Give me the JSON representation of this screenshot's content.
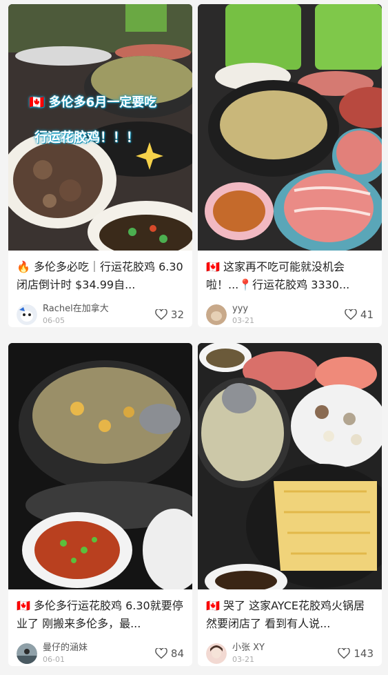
{
  "feed": {
    "cards": [
      {
        "title": "🔥 多伦多必吃｜行运花胶鸡 6.30闭店倒计时 $34.99自...",
        "overlay_line1": "🇨🇦 多伦多6月一定要吃",
        "overlay_line2": "行运花胶鸡！！！",
        "username": "Rachel在加拿大",
        "date": "06-05",
        "likes": "32"
      },
      {
        "title": "🇨🇦 这家再不吃可能就没机会啦！...📍行运花胶鸡 3330...",
        "username": "yyy",
        "date": "03-21",
        "likes": "41"
      },
      {
        "title": "🇨🇦 多伦多行运花胶鸡 6.30就要停业了 刚搬来多伦多，最...",
        "username": "曼仔的涵妹",
        "date": "06-01",
        "likes": "84"
      },
      {
        "title": "🇨🇦 哭了 这家AYCE花胶鸡火锅居然要闭店了 看到有人说...",
        "username": "小张 XY",
        "date": "03-21",
        "likes": "143"
      }
    ]
  },
  "icons": {
    "like": "heart-outline-icon",
    "flag": "canada-flag-icon",
    "fire": "fire-icon",
    "pin": "location-pin-icon"
  },
  "colors": {
    "background": "#f4f4f4",
    "card": "#ffffff",
    "text": "#222222",
    "muted": "#aaaaaa",
    "overlay_glow": "#1aa1c8"
  }
}
